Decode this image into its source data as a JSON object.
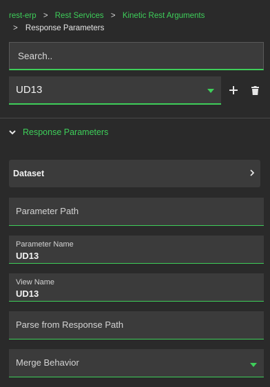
{
  "breadcrumb": {
    "items": [
      "rest-erp",
      "Rest Services",
      "Kinetic Rest Arguments"
    ],
    "current": "Response Parameters",
    "separator": ">"
  },
  "search": {
    "placeholder": "Search..",
    "value": ""
  },
  "selector": {
    "value": "UD13",
    "add_icon": "plus-icon",
    "delete_icon": "trash-icon"
  },
  "section": {
    "title": "Response Parameters",
    "expanded": true
  },
  "dataset": {
    "label": "Dataset"
  },
  "fields": {
    "parameter_path": {
      "placeholder": "Parameter Path",
      "value": ""
    },
    "parameter_name": {
      "label": "Parameter Name",
      "value": "UD13"
    },
    "view_name": {
      "label": "View Name",
      "value": "UD13"
    },
    "parse_from_response_path": {
      "placeholder": "Parse from Response Path",
      "value": ""
    },
    "merge_behavior": {
      "placeholder": "Merge Behavior",
      "value": ""
    }
  },
  "colors": {
    "accent": "#3ecf5a",
    "background": "#2a2a2a",
    "field_bg": "#3b3b3b"
  }
}
